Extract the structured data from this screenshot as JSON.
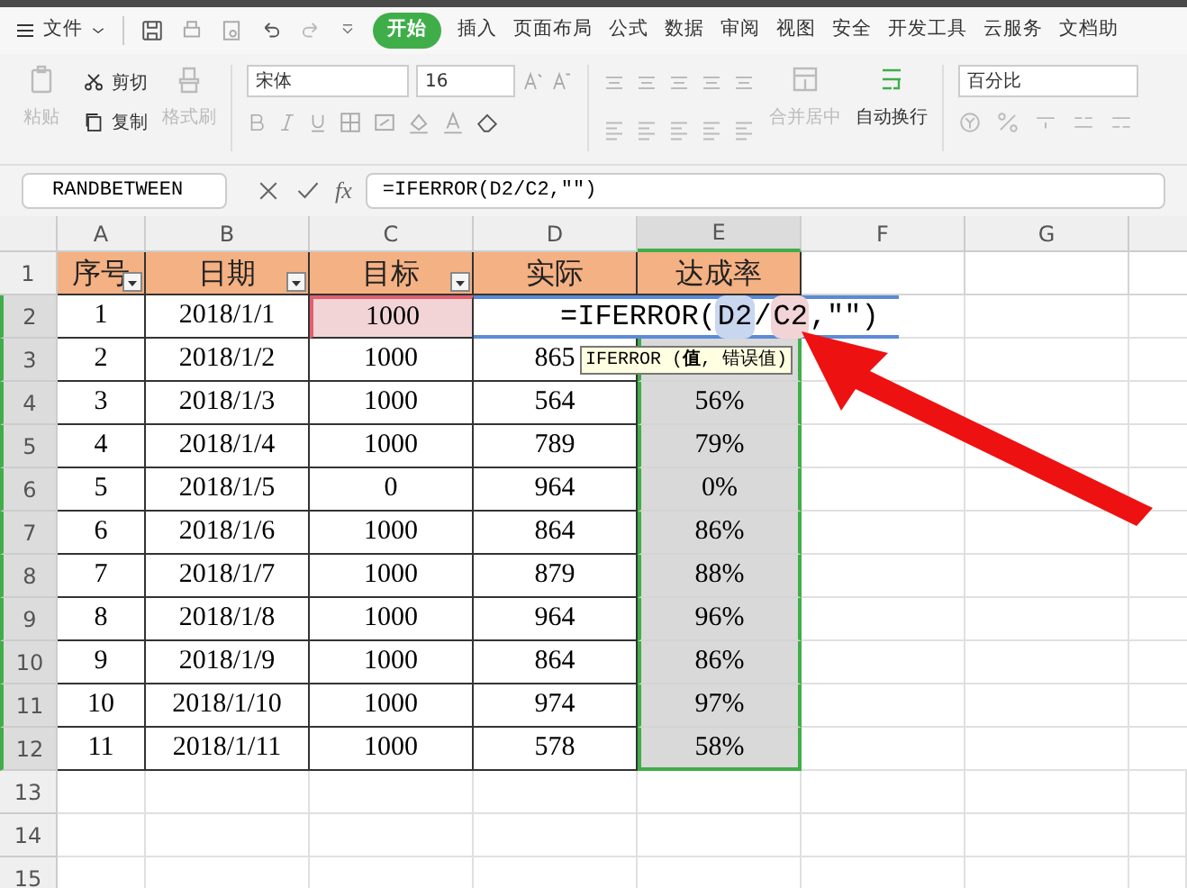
{
  "menu": {
    "file": "文件",
    "tabs": [
      {
        "label": "开始",
        "selected": true
      },
      {
        "label": "插入",
        "selected": false
      },
      {
        "label": "页面布局",
        "selected": false
      },
      {
        "label": "公式",
        "selected": false
      },
      {
        "label": "数据",
        "selected": false
      },
      {
        "label": "审阅",
        "selected": false
      },
      {
        "label": "视图",
        "selected": false
      },
      {
        "label": "安全",
        "selected": false
      },
      {
        "label": "开发工具",
        "selected": false
      },
      {
        "label": "云服务",
        "selected": false
      },
      {
        "label": "文档助",
        "selected": false
      }
    ]
  },
  "ribbon": {
    "paste": "粘贴",
    "cut": "剪切",
    "copy": "复制",
    "format_painter": "格式刷",
    "font": "宋体",
    "size": "16",
    "merge": "合并居中",
    "wrap": "自动换行",
    "number_format": "百分比"
  },
  "formula_bar": {
    "name_box": "RANDBETWEEN",
    "fx": "fx",
    "formula": "=IFERROR(D2/C2,\"\")"
  },
  "columns": [
    "A",
    "B",
    "C",
    "D",
    "E",
    "F",
    "G"
  ],
  "header_row": {
    "number": "1",
    "cells": [
      "序号",
      "日期",
      "目标",
      "实际",
      "达成率"
    ]
  },
  "rows": [
    {
      "number": "2",
      "cells": [
        "1",
        "2018/1/1",
        "1000"
      ],
      "editor": {
        "parts": [
          {
            "kind": "text",
            "text": "=IFERROR("
          },
          {
            "kind": "ref",
            "text": "D2",
            "color": "#c8d6ef"
          },
          {
            "kind": "text",
            "text": "/"
          },
          {
            "kind": "ref",
            "text": "C2",
            "color": "#f2d3d6"
          },
          {
            "kind": "text",
            "text": ",\"\")"
          }
        ]
      }
    },
    {
      "number": "3",
      "cells": [
        "2",
        "2018/1/2",
        "1000",
        "865",
        ""
      ],
      "tooltip": "IFERROR (**值**, 错误值)"
    },
    {
      "number": "4",
      "cells": [
        "3",
        "2018/1/3",
        "1000",
        "564",
        "56%"
      ]
    },
    {
      "number": "5",
      "cells": [
        "4",
        "2018/1/4",
        "1000",
        "789",
        "79%"
      ]
    },
    {
      "number": "6",
      "cells": [
        "5",
        "2018/1/5",
        "0",
        "964",
        "0%"
      ]
    },
    {
      "number": "7",
      "cells": [
        "6",
        "2018/1/6",
        "1000",
        "864",
        "86%"
      ]
    },
    {
      "number": "8",
      "cells": [
        "7",
        "2018/1/7",
        "1000",
        "879",
        "88%"
      ]
    },
    {
      "number": "9",
      "cells": [
        "8",
        "2018/1/8",
        "1000",
        "964",
        "96%"
      ]
    },
    {
      "number": "10",
      "cells": [
        "9",
        "2018/1/9",
        "1000",
        "864",
        "86%"
      ]
    },
    {
      "number": "11",
      "cells": [
        "10",
        "2018/1/10",
        "1000",
        "974",
        "97%"
      ]
    },
    {
      "number": "12",
      "cells": [
        "11",
        "2018/1/11",
        "1000",
        "578",
        "58%"
      ]
    }
  ],
  "empty_rows": [
    "13",
    "14",
    "15"
  ]
}
